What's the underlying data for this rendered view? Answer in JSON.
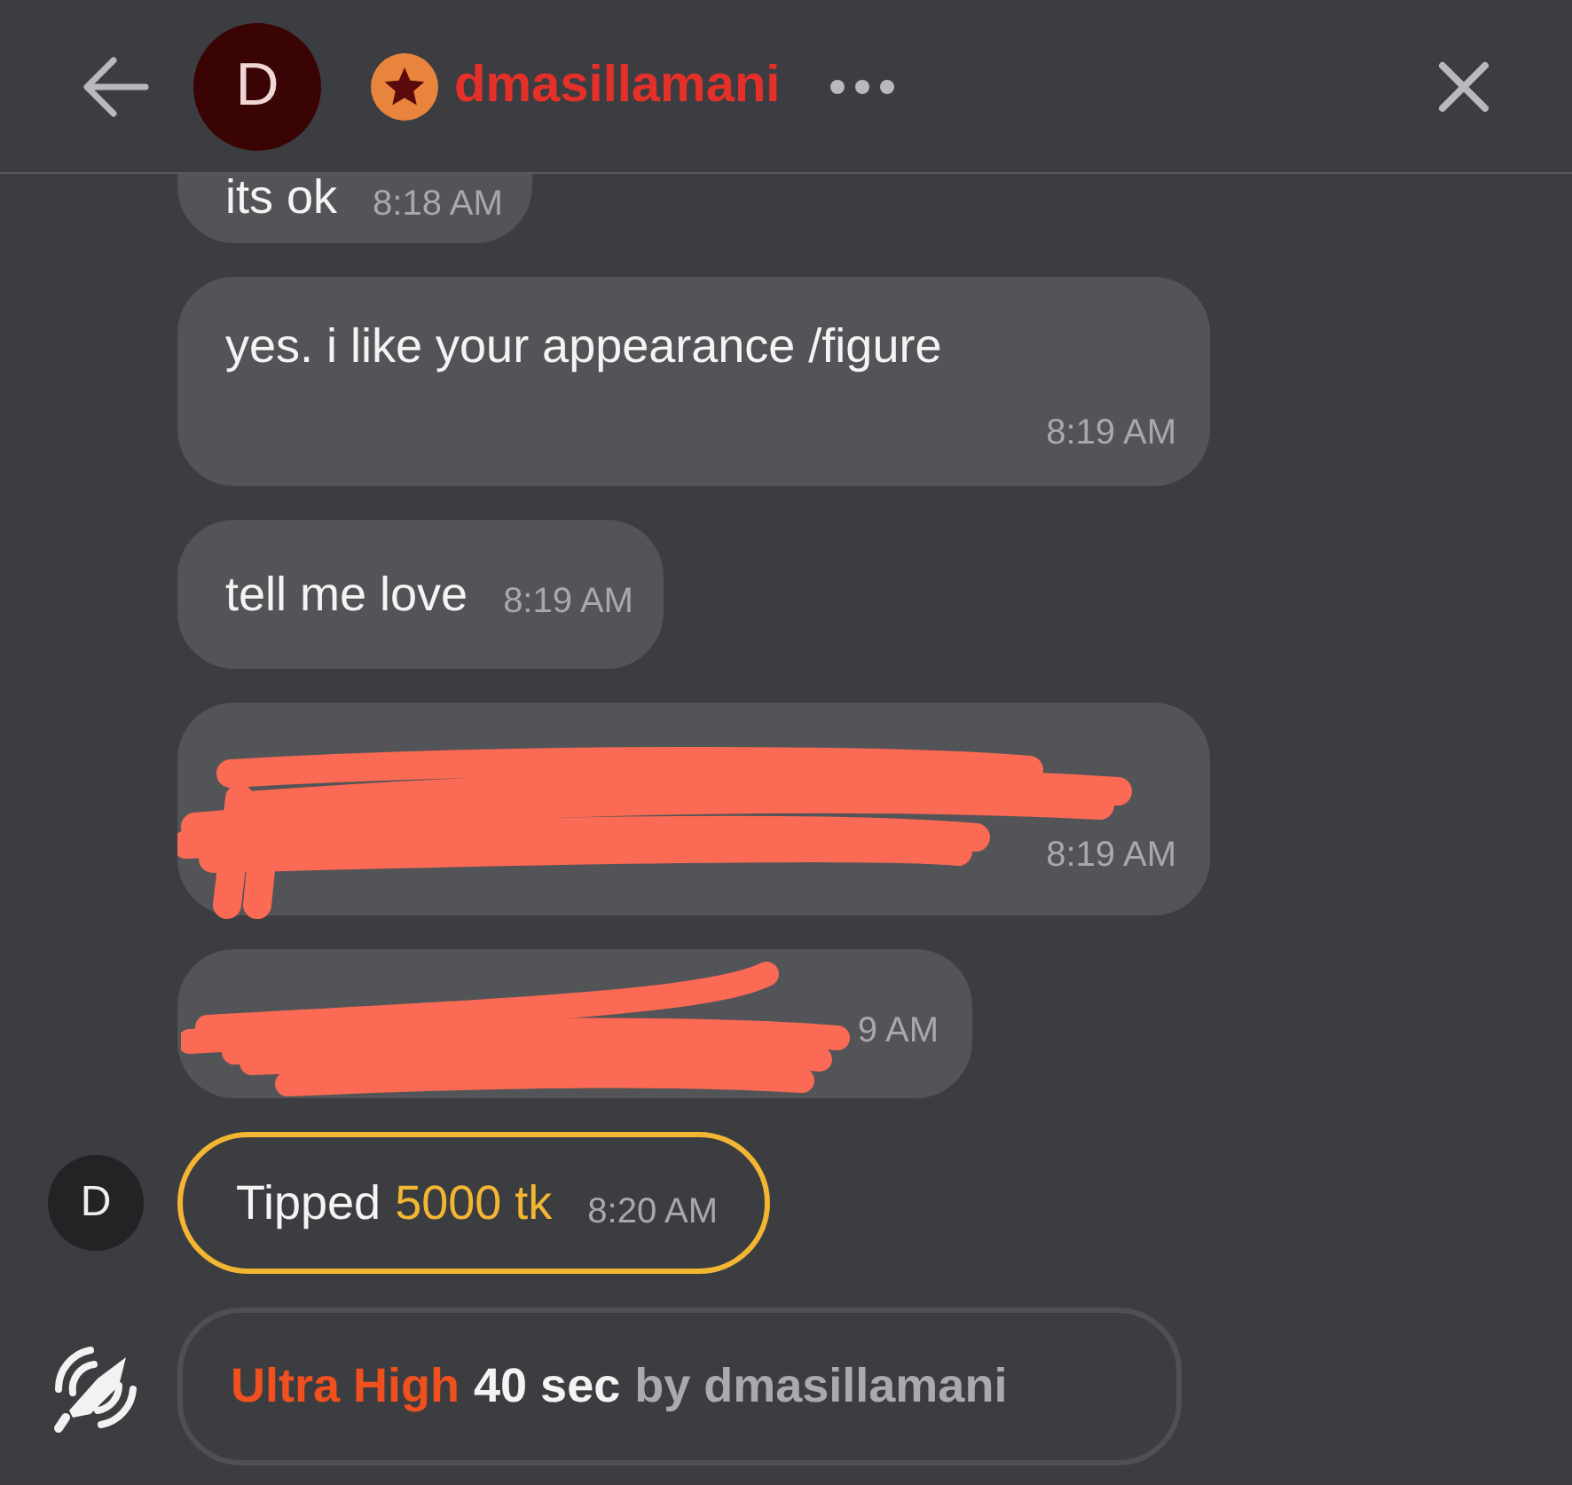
{
  "header": {
    "avatar_letter": "D",
    "username": "dmasillamani"
  },
  "messages": [
    {
      "kind": "text",
      "text": "its ok",
      "time": "8:18 AM"
    },
    {
      "kind": "text",
      "text": "yes. i like your appearance /figure",
      "time": "8:19 AM"
    },
    {
      "kind": "text",
      "text": "tell me love",
      "time": "8:19 AM"
    },
    {
      "kind": "redacted-long",
      "time": "8:19 AM"
    },
    {
      "kind": "redacted-short",
      "time": "9 AM"
    },
    {
      "kind": "tip",
      "avatar_letter": "D",
      "label": "Tipped",
      "amount": "5000 tk",
      "time": "8:20 AM"
    },
    {
      "kind": "notice",
      "level": "Ultra High",
      "duration": "40 sec",
      "by": "by dmasillamani"
    }
  ]
}
